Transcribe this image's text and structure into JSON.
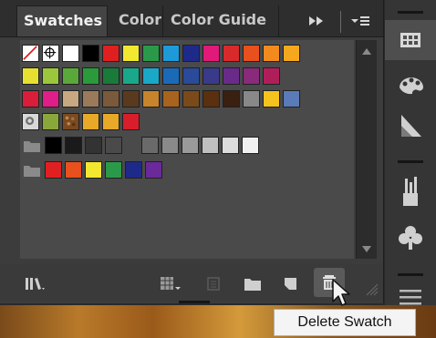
{
  "tabs": [
    {
      "label": "Swatches",
      "active": true
    },
    {
      "label": "Color",
      "active": false
    },
    {
      "label": "Color Guide",
      "active": false
    }
  ],
  "swatch_rows": [
    [
      "none",
      "registration",
      "#ffffff",
      "#000000",
      "#e02020",
      "#f2e830",
      "#2a9a4a",
      "#1e9ad8",
      "#1e2a8a",
      "#e0197a",
      "#d82a2a",
      "#e8501e",
      "#f28a1e",
      "#f5a81e"
    ],
    [
      "#e6e030",
      "#9ac83a",
      "#5aa83a",
      "#2a9a3a",
      "#1a7a3a",
      "#1aa88a",
      "#1aa8c8",
      "#1a6ab8",
      "#2a4a9a",
      "#3a3a8a",
      "#6a2a8a",
      "#8a2a7a",
      "#b01e5a"
    ],
    [
      "#d81e3a",
      "#e01e8a",
      "#c8a880",
      "#9a7a5a",
      "#7a5a3a",
      "#5a3a1e",
      "#c8842a",
      "#a8641e",
      "#7a4a1a",
      "#5a3010",
      "#3a2010",
      "#888888",
      "#f5c21e",
      "#5a7ab8"
    ],
    [
      "pattern-dots",
      "#8aa83a",
      "pattern-leaves",
      "#e8a828",
      "#e8a828",
      "#d81e2a"
    ],
    [
      "folder",
      "#000000",
      "#1a1a1a",
      "#333333",
      "#4a4a4a",
      "gap",
      "#6a6a6a",
      "#8a8a8a",
      "#9a9a9a",
      "#c0c0c0",
      "#dcdcdc",
      "#f0f0f0"
    ],
    [
      "folder",
      "#e02020",
      "#e8501e",
      "#f2e830",
      "#2a9a4a",
      "#1e2a8a",
      "#6a2a9a"
    ]
  ],
  "bottom_icons": [
    "library-icon",
    "swatch-kind-icon",
    "swatch-options-icon",
    "new-group-icon",
    "new-swatch-icon",
    "delete-swatch-icon"
  ],
  "dock_icons": [
    "swatches-panel-icon",
    "color-panel-icon",
    "color-guide-panel-icon",
    "brushes-panel-icon",
    "symbols-panel-icon",
    "menu-icon"
  ],
  "tooltip": {
    "text": "Delete Swatch"
  }
}
